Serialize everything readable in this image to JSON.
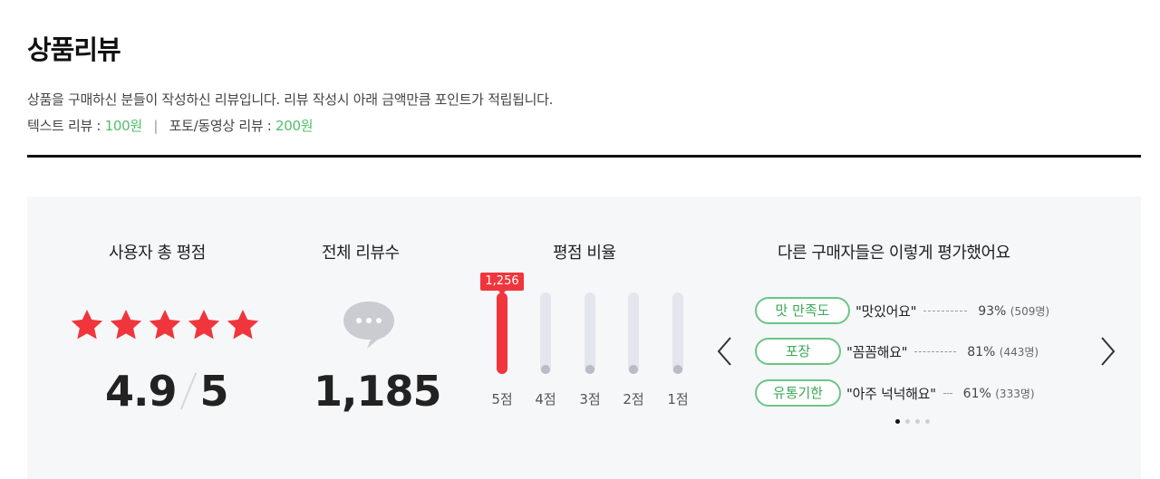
{
  "header": {
    "title": "상품리뷰",
    "description": "상품을 구매하신 분들이 작성하신 리뷰입니다. 리뷰 작성시 아래 금액만큼 포인트가 적립됩니다.",
    "text_review_label": "텍스트 리뷰 :",
    "text_review_points": "100원",
    "separator": "|",
    "photo_review_label": "포토/동영상 리뷰 :",
    "photo_review_points": "200원"
  },
  "summary": {
    "rating_title": "사용자 총 평점",
    "rating_value": "4.9",
    "rating_max": "5",
    "stars_filled": 5,
    "review_count_title": "전체 리뷰수",
    "review_count": "1,185",
    "ratio_title": "평점 비율",
    "ratio_top_count": "1,256",
    "ratio_labels": [
      "5점",
      "4점",
      "3점",
      "2점",
      "1점"
    ],
    "others_title": "다른 구매자들은 이렇게 평가했어요",
    "evaluations": [
      {
        "tag": "맛 만족도",
        "quote": "\"맛있어요\"",
        "percent": "93%",
        "people": "(509명)"
      },
      {
        "tag": "포장",
        "quote": "\"꼼꼼해요\"",
        "percent": "81%",
        "people": "(443명)"
      },
      {
        "tag": "유통기한",
        "quote": "\"아주 넉넉해요\"",
        "percent": "61%",
        "people": "(333명)"
      }
    ],
    "page_indicator": {
      "current": 1,
      "total": 4
    }
  },
  "colors": {
    "accent_red": "#f0363c",
    "accent_green": "#4fbf6a",
    "panel_bg": "#f6f7f9"
  }
}
